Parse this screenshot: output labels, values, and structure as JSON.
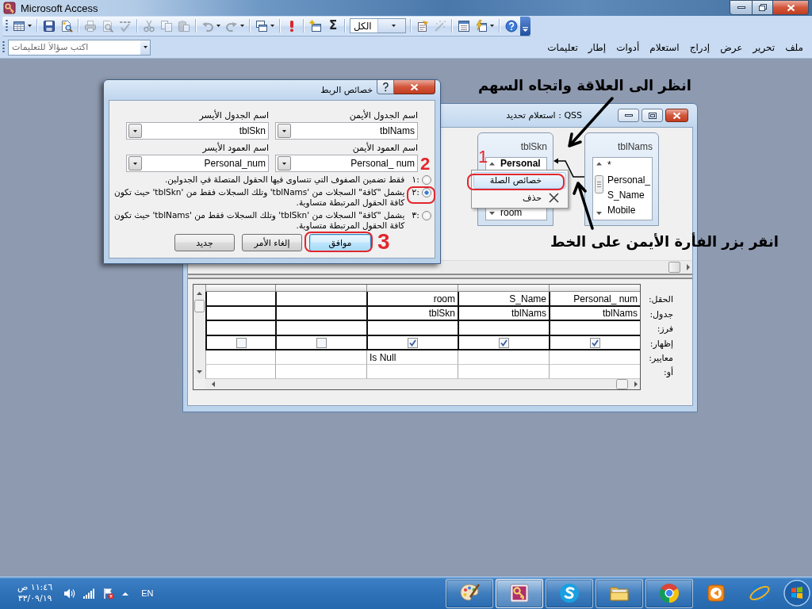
{
  "app_window": {
    "title": "Microsoft Access"
  },
  "toolbar": {
    "buttons": [
      {
        "disabled": false
      },
      {
        "disabled": false
      },
      {
        "disabled": false
      },
      {
        "disabled": true
      },
      {
        "disabled": true
      },
      {
        "disabled": true
      },
      {
        "disabled": true
      },
      {
        "disabled": true
      },
      {
        "disabled": true
      },
      {
        "disabled": true
      },
      {
        "disabled": true
      },
      {
        "disabled": false
      },
      {
        "disabled": false
      },
      {
        "disabled": false
      },
      {
        "disabled": false,
        "label": "Σ"
      },
      {
        "disabled": false
      },
      {
        "disabled": true
      },
      {
        "disabled": false
      },
      {
        "disabled": false
      },
      {
        "disabled": false
      }
    ],
    "object_combo": {
      "value": "الكل"
    }
  },
  "help_box": {
    "placeholder": "اكتب سؤالاً للتعليمات"
  },
  "menu_bar": [
    "ملف",
    "تحرير",
    "عرض",
    "إدراج",
    "استعلام",
    "أدوات",
    "إطار",
    "تعليمات"
  ],
  "query_window": {
    "title": "QSS : استعلام تحديد",
    "tables": [
      {
        "name": "tblNams",
        "fields": [
          {
            "name": "*",
            "key": false
          },
          {
            "name": "Personal_",
            "key": false
          },
          {
            "name": "S_Name",
            "key": false
          },
          {
            "name": "Mobile",
            "key": false
          }
        ]
      },
      {
        "name": "tblSkn",
        "fields": [
          {
            "name": "Personal",
            "key": true
          },
          {
            "name": "room",
            "key": false
          }
        ]
      }
    ],
    "context_menu": [
      {
        "label": "خصائص الصلة",
        "kind": "plain",
        "selected": true,
        "circled": true
      },
      {
        "label": "حذف",
        "kind": "delete",
        "selected": false,
        "circled": false
      }
    ],
    "grid": {
      "row_labels": [
        "الحقل:",
        "جدول:",
        "فرز:",
        "إظهار:",
        "معايير:",
        "أو:"
      ],
      "columns": [
        {
          "field": "Personal_ num",
          "table": "tblNams",
          "show": true
        },
        {
          "field": "S_Name",
          "table": "tblNams",
          "show": true
        },
        {
          "field": "room",
          "table": "tblSkn",
          "show": true,
          "criteria": "Is Null"
        },
        {
          "show": false
        },
        {
          "show": false
        }
      ]
    }
  },
  "join_dialog": {
    "title": "خصائص الربط",
    "fields": [
      {
        "label": "اسم الجدول الأيمن",
        "value": "tblNams"
      },
      {
        "label": "اسم الجدول الأيسر",
        "value": "tblSkn"
      },
      {
        "label": "اسم العمود الأيمن",
        "value": "Personal_ num"
      },
      {
        "label": "اسم العمود الأيسر",
        "value": "Personal_num"
      }
    ],
    "options": [
      {
        "number": "١:",
        "text": "فقط تضمين الصفوف التي تتساوى فيها الحقول المتصلة في الجدولين.",
        "selected": false,
        "circled": false
      },
      {
        "number": "٢:",
        "text": "يشمل \"كافة\" السجلات من 'tblNams' وتلك السجلات فقط من 'tblSkn' حيث تكون كافة الحقول المرتبطة متساوية.",
        "selected": true,
        "circled": true
      },
      {
        "number": "٣:",
        "text": "يشمل \"كافة\" السجلات من 'tblSkn' وتلك السجلات فقط من 'tblNams' حيث تكون كافة الحقول المرتبطة متساوية.",
        "selected": false,
        "circled": false
      }
    ],
    "buttons": [
      {
        "label": "موافق",
        "default": true,
        "circled": true
      },
      {
        "label": "إلغاء الأمر",
        "default": false,
        "circled": false
      },
      {
        "label": "جديد",
        "default": false,
        "circled": false
      }
    ]
  },
  "notes": [
    "انظر الى العلاقة واتجاه السهم",
    "انقر بزر الفأرة الأيمن على الخط"
  ],
  "callouts": [
    "1",
    "2",
    "3"
  ],
  "taskbar": {
    "clock": {
      "time": "١١:٤٦ ص",
      "date": "٣٣/٠٩/١٩"
    },
    "language": "EN",
    "buttons": [
      {
        "running": true,
        "active": false
      },
      {
        "running": true,
        "active": true
      },
      {
        "running": true,
        "active": false
      },
      {
        "running": true,
        "active": false
      },
      {
        "running": true,
        "active": false
      },
      {
        "running": false,
        "active": false
      },
      {
        "running": false,
        "active": false
      }
    ]
  }
}
